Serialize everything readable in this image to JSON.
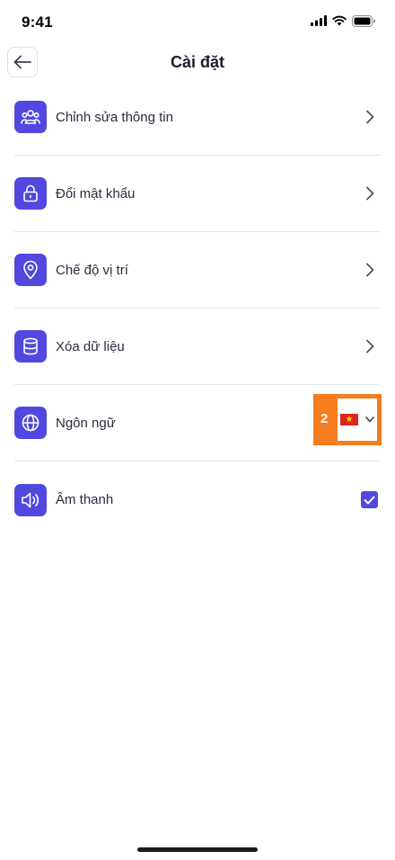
{
  "status_bar": {
    "time": "9:41"
  },
  "header": {
    "title": "Cài đặt"
  },
  "menu": {
    "items": [
      {
        "label": "Chỉnh sửa thông tin",
        "icon": "users-icon",
        "trailing": "chevron"
      },
      {
        "label": "Đổi mật khẩu",
        "icon": "lock-icon",
        "trailing": "chevron"
      },
      {
        "label": "Chế độ vị trí",
        "icon": "location-pin-icon",
        "trailing": "chevron"
      },
      {
        "label": "Xóa dữ liệu",
        "icon": "database-icon",
        "trailing": "chevron"
      },
      {
        "label": "Ngôn ngữ",
        "icon": "globe-icon",
        "trailing": "language-select"
      },
      {
        "label": "Âm thanh",
        "icon": "speaker-icon",
        "trailing": "checkbox"
      }
    ]
  },
  "language": {
    "badge_number": "2",
    "selected": "vietnam-flag",
    "checked_sound": true
  },
  "colors": {
    "accent": "#5148e0",
    "badge": "#f57c1f",
    "divider": "#e6e7eb"
  }
}
